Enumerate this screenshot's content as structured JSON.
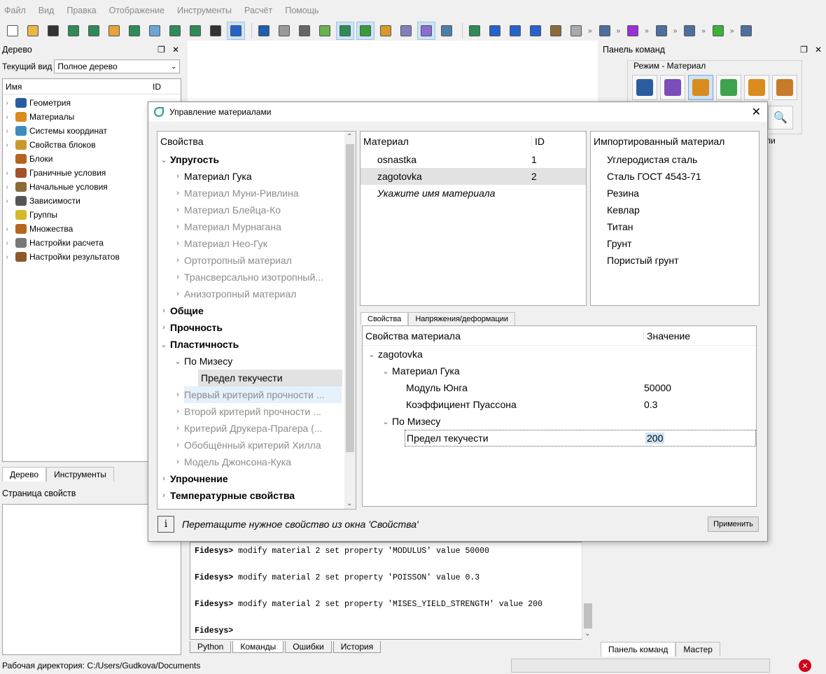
{
  "menu": [
    "Файл",
    "Вид",
    "Правка",
    "Отображение",
    "Инструменты",
    "Расчёт",
    "Помощь"
  ],
  "left_dock": {
    "title": "Дерево",
    "view_label": "Текущий вид",
    "view_value": "Полное дерево",
    "col_name": "Имя",
    "col_id": "ID",
    "items": [
      "Геометрия",
      "Материалы",
      "Системы координат",
      "Свойства блоков",
      "Блоки",
      "Граничные условия",
      "Начальные условия",
      "Зависимости",
      "Группы",
      "Множества",
      "Настройки расчета",
      "Настройки результатов"
    ],
    "tabs": [
      "Дерево",
      "Инструменты"
    ],
    "props_title": "Страница свойств"
  },
  "right_dock": {
    "title": "Панель команд",
    "mode": "Режим - Материал",
    "tabs": [
      "Панель команд",
      "Мастер"
    ]
  },
  "dialog": {
    "title": "Управление материалами",
    "props_header": "Свойства",
    "props_tree": [
      {
        "label": "Упругость",
        "level": 0,
        "style": "bold",
        "arrow": "open"
      },
      {
        "label": "Материал Гука",
        "level": 1,
        "style": "normal",
        "arrow": "closed"
      },
      {
        "label": "Материал Муни-Ривлина",
        "level": 1,
        "style": "gray",
        "arrow": "closed"
      },
      {
        "label": "Материал Блейца-Ко",
        "level": 1,
        "style": "gray",
        "arrow": "closed"
      },
      {
        "label": "Материал Мурнагана",
        "level": 1,
        "style": "gray",
        "arrow": "closed"
      },
      {
        "label": "Материал Нео-Гук",
        "level": 1,
        "style": "gray",
        "arrow": "closed"
      },
      {
        "label": "Ортотропный материал",
        "level": 1,
        "style": "gray",
        "arrow": "closed"
      },
      {
        "label": "Трансверсально изотропный...",
        "level": 1,
        "style": "gray",
        "arrow": "closed"
      },
      {
        "label": "Анизотропный материал",
        "level": 1,
        "style": "gray",
        "arrow": "closed"
      },
      {
        "label": "Общие",
        "level": 0,
        "style": "bold",
        "arrow": "closed"
      },
      {
        "label": "Прочность",
        "level": 0,
        "style": "bold",
        "arrow": "closed"
      },
      {
        "label": "Пластичность",
        "level": 0,
        "style": "bold",
        "arrow": "open"
      },
      {
        "label": "По Мизесу",
        "level": 1,
        "style": "normal",
        "arrow": "open"
      },
      {
        "label": "Предел текучести",
        "level": 2,
        "style": "selected",
        "arrow": "none"
      },
      {
        "label": "Первый критерий прочности ...",
        "level": 1,
        "style": "hover",
        "arrow": "closed"
      },
      {
        "label": "Второй критерий прочности ...",
        "level": 1,
        "style": "gray",
        "arrow": "closed"
      },
      {
        "label": "Критерий Друкера-Прагера (...",
        "level": 1,
        "style": "gray",
        "arrow": "closed"
      },
      {
        "label": "Обобщённый критерий Хилла",
        "level": 1,
        "style": "gray",
        "arrow": "closed"
      },
      {
        "label": "Модель Джонсона-Кука",
        "level": 1,
        "style": "gray",
        "arrow": "closed"
      },
      {
        "label": "Упрочнение",
        "level": 0,
        "style": "bold",
        "arrow": "closed"
      },
      {
        "label": "Температурные свойства",
        "level": 0,
        "style": "bold",
        "arrow": "closed"
      }
    ],
    "materials_header": {
      "name": "Материал",
      "id": "ID"
    },
    "materials": [
      {
        "name": "osnastka",
        "id": "1"
      },
      {
        "name": "zagotovka",
        "id": "2"
      }
    ],
    "materials_placeholder": "Укажите имя материала",
    "imported_header": "Импортированный материал",
    "imported": [
      "Углеродистая сталь",
      "Сталь ГОСТ 4543-71",
      "Резина",
      "Кевлар",
      "Титан",
      "Грунт",
      "Пористый грунт"
    ],
    "tabs": [
      "Свойства",
      "Напряжения/деформации"
    ],
    "prop_table_header": {
      "name": "Свойства материала",
      "value": "Значение"
    },
    "prop_table": [
      {
        "label": "zagotovka",
        "value": "",
        "level": 0,
        "arrow": "open"
      },
      {
        "label": "Материал Гука",
        "value": "",
        "level": 1,
        "arrow": "open"
      },
      {
        "label": "Модуль Юнга",
        "value": "50000",
        "level": 2,
        "arrow": "none"
      },
      {
        "label": "Коэффициент Пуассона",
        "value": "0.3",
        "level": 2,
        "arrow": "none"
      },
      {
        "label": "По Мизесу",
        "value": "",
        "level": 1,
        "arrow": "open"
      },
      {
        "label": "Предел текучести",
        "value": "200",
        "level": 2,
        "arrow": "none"
      }
    ],
    "hint": "Перетащите нужное свойство из окна 'Свойства'",
    "apply_label": "Применить"
  },
  "console": {
    "prompt": "Fidesys>",
    "lines": [
      "modify material 2 set property 'MODULUS' value 50000",
      "modify material 2 set property 'POISSON' value 0.3",
      "modify material 2 set property 'MISES_YIELD_STRENGTH' value 200",
      ""
    ],
    "tabs": [
      "Python",
      "Команды",
      "Ошибки",
      "История"
    ]
  },
  "status": {
    "workdir": "Рабочая директория: C:/Users/Gudkova/Documents"
  },
  "colors": {
    "accent": "#0a7ae0",
    "selection": "#e2e2e2",
    "hover": "#e5f1fb",
    "error": "#d0021b"
  }
}
